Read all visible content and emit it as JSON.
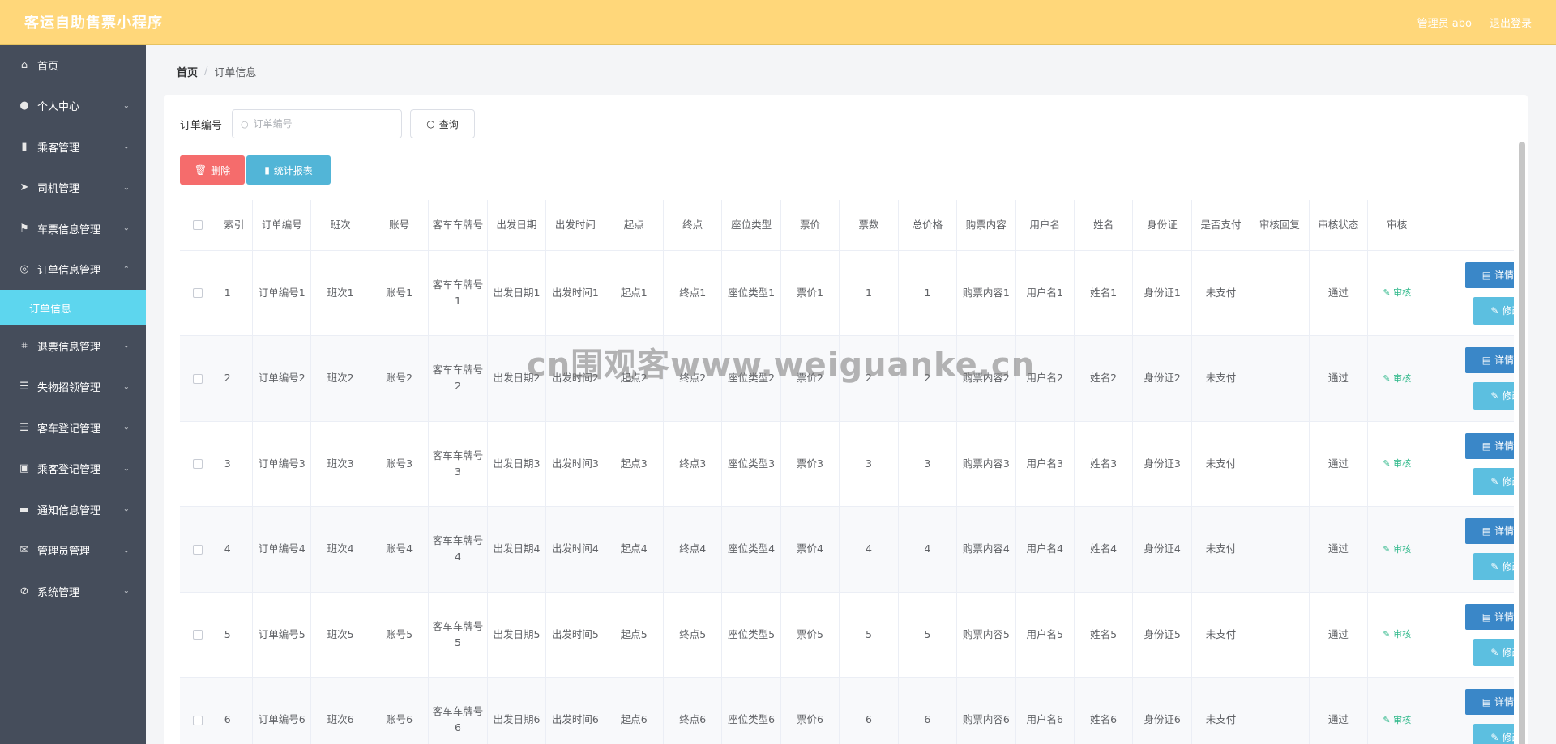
{
  "header": {
    "title": "客运自助售票小程序",
    "admin_label": "管理员 abo",
    "logout_label": "退出登录"
  },
  "sidebar": {
    "items": [
      {
        "label": "首页",
        "icon": "home-icon"
      },
      {
        "label": "个人中心",
        "icon": "user-icon"
      },
      {
        "label": "乘客管理",
        "icon": "bar-chart-icon"
      },
      {
        "label": "司机管理",
        "icon": "send-icon"
      },
      {
        "label": "车票信息管理",
        "icon": "flag-icon"
      },
      {
        "label": "订单信息管理",
        "icon": "target-icon"
      },
      {
        "label": "退票信息管理",
        "icon": "crop-icon"
      },
      {
        "label": "失物招领管理",
        "icon": "list-icon"
      },
      {
        "label": "客车登记管理",
        "icon": "list-icon"
      },
      {
        "label": "乘客登记管理",
        "icon": "clipboard-icon"
      },
      {
        "label": "通知信息管理",
        "icon": "ticket-icon"
      },
      {
        "label": "管理员管理",
        "icon": "mail-icon"
      },
      {
        "label": "系统管理",
        "icon": "bell-off-icon"
      }
    ],
    "active_sub": "订单信息"
  },
  "breadcrumb": {
    "home": "首页",
    "sep": "/",
    "current": "订单信息"
  },
  "search": {
    "label": "订单编号",
    "placeholder": "订单编号",
    "query_label": "查询"
  },
  "actions": {
    "delete_label": "删除",
    "stats_label": "统计报表"
  },
  "table": {
    "headers": [
      "索引",
      "订单编号",
      "班次",
      "账号",
      "客车车牌号",
      "出发日期",
      "出发时间",
      "起点",
      "终点",
      "座位类型",
      "票价",
      "票数",
      "总价格",
      "购票内容",
      "用户名",
      "姓名",
      "身份证",
      "是否支付",
      "审核回复",
      "审核状态",
      "审核"
    ],
    "audit_label": "审核",
    "detail_label": "详情",
    "edit_label": "修改",
    "rows": [
      [
        "1",
        "订单编号1",
        "班次1",
        "账号1",
        "客车车牌号1",
        "出发日期1",
        "出发时间1",
        "起点1",
        "终点1",
        "座位类型1",
        "票价1",
        "1",
        "1",
        "购票内容1",
        "用户名1",
        "姓名1",
        "身份证1",
        "未支付",
        "",
        "通过"
      ],
      [
        "2",
        "订单编号2",
        "班次2",
        "账号2",
        "客车车牌号2",
        "出发日期2",
        "出发时间2",
        "起点2",
        "终点2",
        "座位类型2",
        "票价2",
        "2",
        "2",
        "购票内容2",
        "用户名2",
        "姓名2",
        "身份证2",
        "未支付",
        "",
        "通过"
      ],
      [
        "3",
        "订单编号3",
        "班次3",
        "账号3",
        "客车车牌号3",
        "出发日期3",
        "出发时间3",
        "起点3",
        "终点3",
        "座位类型3",
        "票价3",
        "3",
        "3",
        "购票内容3",
        "用户名3",
        "姓名3",
        "身份证3",
        "未支付",
        "",
        "通过"
      ],
      [
        "4",
        "订单编号4",
        "班次4",
        "账号4",
        "客车车牌号4",
        "出发日期4",
        "出发时间4",
        "起点4",
        "终点4",
        "座位类型4",
        "票价4",
        "4",
        "4",
        "购票内容4",
        "用户名4",
        "姓名4",
        "身份证4",
        "未支付",
        "",
        "通过"
      ],
      [
        "5",
        "订单编号5",
        "班次5",
        "账号5",
        "客车车牌号5",
        "出发日期5",
        "出发时间5",
        "起点5",
        "终点5",
        "座位类型5",
        "票价5",
        "5",
        "5",
        "购票内容5",
        "用户名5",
        "姓名5",
        "身份证5",
        "未支付",
        "",
        "通过"
      ],
      [
        "6",
        "订单编号6",
        "班次6",
        "账号6",
        "客车车牌号6",
        "出发日期6",
        "出发时间6",
        "起点6",
        "终点6",
        "座位类型6",
        "票价6",
        "6",
        "6",
        "购票内容6",
        "用户名6",
        "姓名6",
        "身份证6",
        "未支付",
        "",
        "通过"
      ]
    ]
  },
  "watermark": "cn围观客www.weiguanke.cn",
  "colors": {
    "header_bg": "#ffd77a",
    "sidebar_bg": "#454d5b",
    "sidebar_active": "#5dd6ee",
    "danger": "#f56c6c",
    "info": "#52b5d7",
    "primary": "#3a87c8",
    "success": "#2fb88a"
  }
}
